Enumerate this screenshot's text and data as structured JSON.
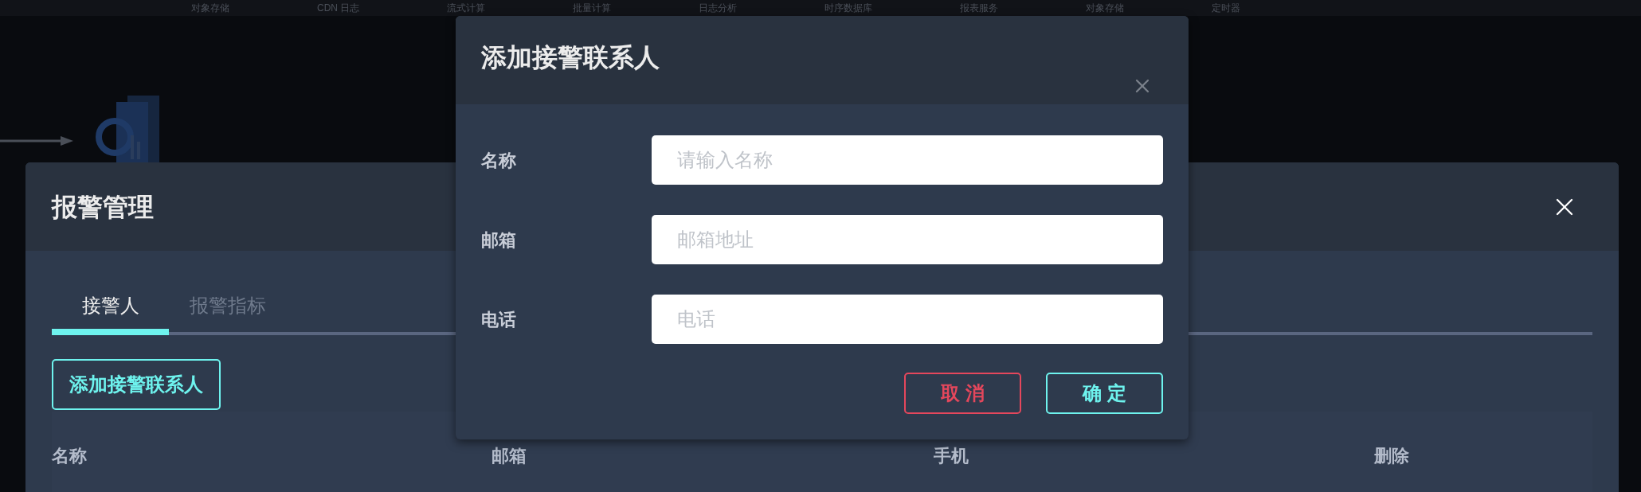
{
  "top_nav": {
    "items": [
      "对象存储",
      "CDN 日志",
      "流式计算",
      "批量计算",
      "日志分析",
      "时序数据库",
      "报表服务",
      "对象存储",
      "定时器"
    ]
  },
  "panel": {
    "title": "报警管理",
    "tabs": [
      {
        "label": "接警人",
        "selected": true
      },
      {
        "label": "报警指标",
        "selected": false
      }
    ],
    "add_button": "添加接警联系人",
    "table": {
      "columns": [
        "名称",
        "邮箱",
        "手机",
        "删除"
      ]
    }
  },
  "dialog": {
    "title": "添加接警联系人",
    "fields": [
      {
        "label": "名称",
        "placeholder": "请输入名称"
      },
      {
        "label": "邮箱",
        "placeholder": "邮箱地址"
      },
      {
        "label": "电话",
        "placeholder": "电话"
      }
    ],
    "buttons": [
      {
        "label": "取 消",
        "kind": "cancel"
      },
      {
        "label": "确 定",
        "kind": "confirm"
      }
    ]
  }
}
